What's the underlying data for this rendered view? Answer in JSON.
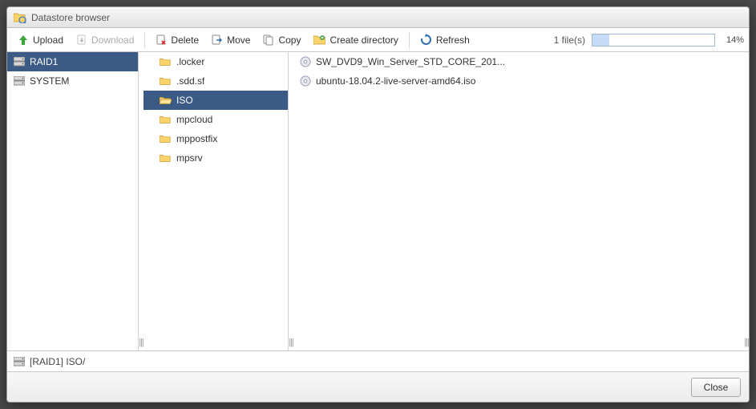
{
  "window": {
    "title": "Datastore browser"
  },
  "toolbar": {
    "upload": "Upload",
    "download": "Download",
    "delete": "Delete",
    "move": "Move",
    "copy": "Copy",
    "create_dir": "Create directory",
    "refresh": "Refresh"
  },
  "upload_status": {
    "file_count_label": "1 file(s)",
    "percent_value": 14,
    "percent_label": "14%"
  },
  "datastores": {
    "items": [
      {
        "name": "RAID1",
        "selected": true
      },
      {
        "name": "SYSTEM",
        "selected": false
      }
    ]
  },
  "folders": {
    "items": [
      {
        "name": ".locker",
        "selected": false
      },
      {
        "name": ".sdd.sf",
        "selected": false
      },
      {
        "name": "ISO",
        "selected": true
      },
      {
        "name": "mpcloud",
        "selected": false
      },
      {
        "name": "mppostfix",
        "selected": false
      },
      {
        "name": "mpsrv",
        "selected": false
      }
    ]
  },
  "files": {
    "items": [
      {
        "name": "SW_DVD9_Win_Server_STD_CORE_201...",
        "type": "iso"
      },
      {
        "name": "ubuntu-18.04.2-live-server-amd64.iso",
        "type": "iso"
      }
    ]
  },
  "status": {
    "path": "[RAID1] ISO/"
  },
  "footer": {
    "close": "Close"
  }
}
